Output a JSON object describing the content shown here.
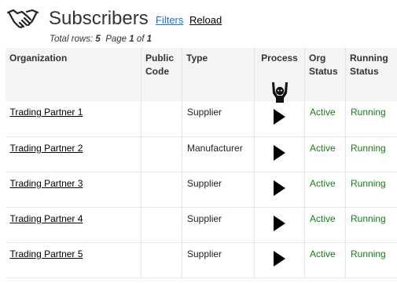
{
  "header": {
    "title": "Subscribers",
    "filters_label": "Filters",
    "reload_label": "Reload"
  },
  "summary": {
    "total_rows_label": "Total rows:",
    "total_rows": "5",
    "page_label": "Page",
    "page_current": "1",
    "page_of": "of",
    "page_total": "1"
  },
  "table": {
    "columns": [
      {
        "label": "Organization"
      },
      {
        "label": "Public Code"
      },
      {
        "label": "Type"
      },
      {
        "label": "Process"
      },
      {
        "label": "Org Status"
      },
      {
        "label": "Running Status"
      }
    ],
    "rows": [
      {
        "organization": "Trading Partner 1",
        "public_code": "",
        "type": "Supplier",
        "org_status": "Active",
        "running_status": "Running"
      },
      {
        "organization": "Trading Partner 2",
        "public_code": "",
        "type": "Manufacturer",
        "org_status": "Active",
        "running_status": "Running"
      },
      {
        "organization": "Trading Partner 3",
        "public_code": "",
        "type": "Supplier",
        "org_status": "Active",
        "running_status": "Running"
      },
      {
        "organization": "Trading Partner 4",
        "public_code": "",
        "type": "Supplier",
        "org_status": "Active",
        "running_status": "Running"
      },
      {
        "organization": "Trading Partner 5",
        "public_code": "",
        "type": "Supplier",
        "org_status": "Active",
        "running_status": "Running"
      }
    ]
  },
  "icons": {
    "logo": "handshake-icon",
    "process_header": "person-hands-up-icon",
    "process_action": "play-icon"
  },
  "colors": {
    "link_blue": "#1a6fc7",
    "status_green": "#1a7a1a",
    "header_bg": "#f4f4f4"
  }
}
